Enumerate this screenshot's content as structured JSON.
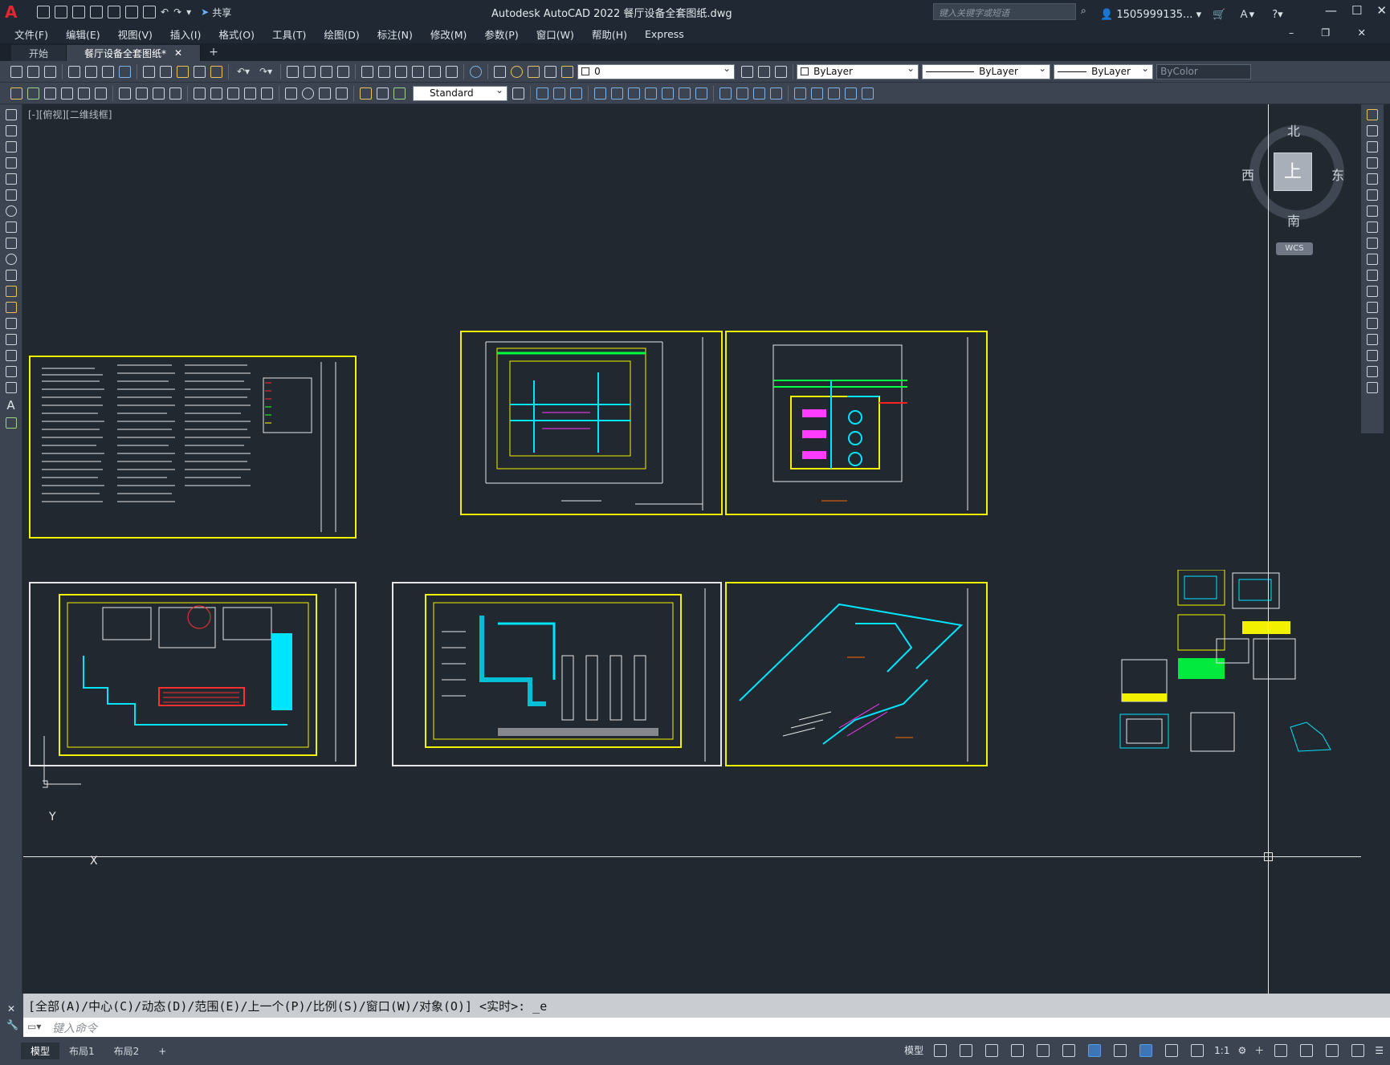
{
  "app": {
    "title": "Autodesk AutoCAD 2022    餐厅设备全套图纸.dwg",
    "share_label": "共享",
    "search_placeholder": "键入关键字或短语",
    "user": "1505999135..."
  },
  "menu": [
    "文件(F)",
    "编辑(E)",
    "视图(V)",
    "插入(I)",
    "格式(O)",
    "工具(T)",
    "绘图(D)",
    "标注(N)",
    "修改(M)",
    "参数(P)",
    "窗口(W)",
    "帮助(H)",
    "Express"
  ],
  "tabs": {
    "start": "开始",
    "file": "餐厅设备全套图纸*",
    "add": "+"
  },
  "toolbar": {
    "layer": "0",
    "color": "ByLayer",
    "linetype": "ByLayer",
    "lineweight": "ByLayer",
    "plotstyle": "ByColor",
    "textstyle": "Standard"
  },
  "viewport": {
    "label": "[-][俯视][二维线框]"
  },
  "viewcube": {
    "north": "北",
    "south": "南",
    "east": "东",
    "west": "西",
    "top": "上",
    "wcs": "WCS"
  },
  "ucs": {
    "x": "X",
    "y": "Y"
  },
  "command": {
    "history": "[全部(A)/中心(C)/动态(D)/范围(E)/上一个(P)/比例(S)/窗口(W)/对象(O)] <实时>: _e",
    "placeholder": "键入命令"
  },
  "status": {
    "model_tab": "模型",
    "layout1": "布局1",
    "layout2": "布局2",
    "model_label": "模型",
    "scale": "1:1"
  },
  "colors": {
    "canvas": "#212830",
    "sheet_border": "#f2f200",
    "cyan": "#00e5ff",
    "green": "#00ff40"
  }
}
